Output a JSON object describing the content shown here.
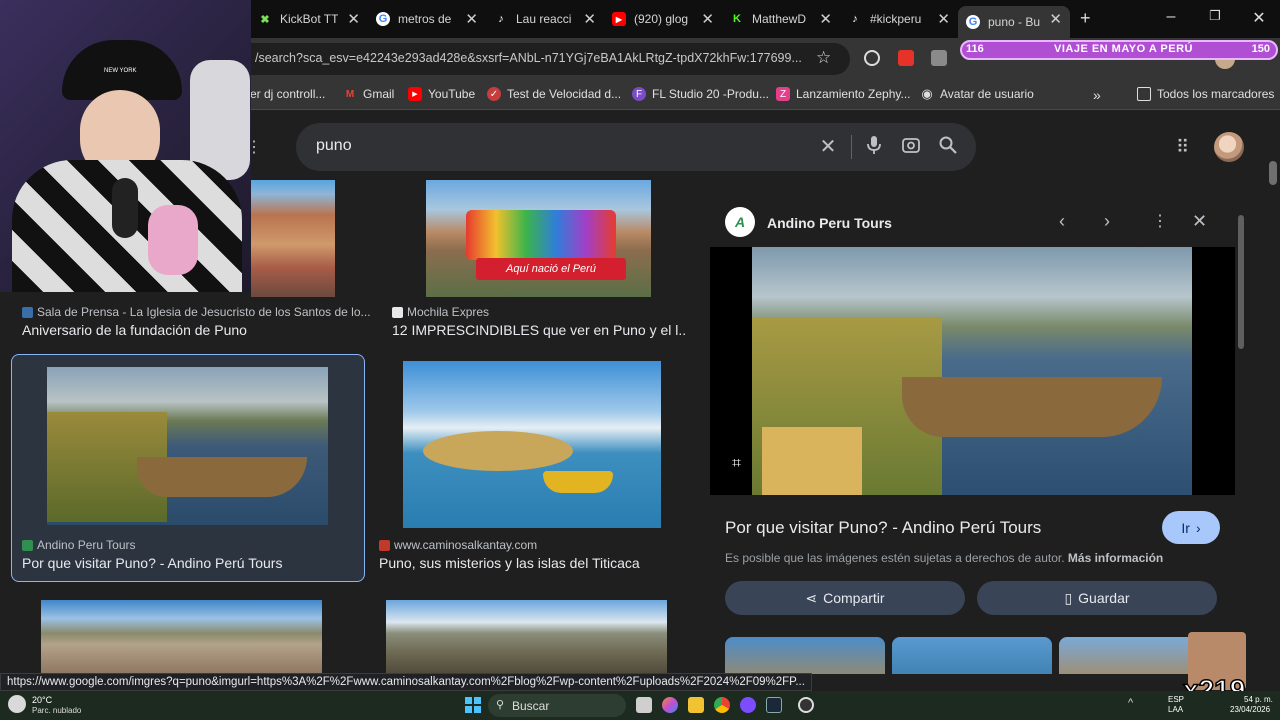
{
  "tabs": [
    {
      "label": "KickBot TT",
      "icon": "kickbot-icon"
    },
    {
      "label": "metros de",
      "icon": "google-icon"
    },
    {
      "label": "Lau reacci",
      "icon": "tiktok-icon"
    },
    {
      "label": "(920) glog",
      "icon": "youtube-icon"
    },
    {
      "label": "MatthewD",
      "icon": "kick-icon"
    },
    {
      "label": "#kickperu",
      "icon": "tiktok-icon"
    },
    {
      "label": "puno - Bu",
      "icon": "google-icon",
      "active": true
    }
  ],
  "address": {
    "url": "/search?sca_esv=e42243e293ad428e&sxsrf=ANbL-n71YGj7eBA1AkLRtgZ-tpdX72khFw:177699..."
  },
  "bookmarks": [
    {
      "label": "er dj controll...",
      "icon": ""
    },
    {
      "label": "Gmail",
      "icon": "gmail-icon"
    },
    {
      "label": "YouTube",
      "icon": "youtube-icon"
    },
    {
      "label": "Test de Velocidad d...",
      "icon": "speedtest-icon"
    },
    {
      "label": "FL Studio 20 -Produ...",
      "icon": "flstudio-icon"
    },
    {
      "label": "Lanzamiento Zephy...",
      "icon": "zephyr-icon"
    },
    {
      "label": "Avatar de usuario",
      "icon": "globe-icon"
    }
  ],
  "bookmarks_all": "Todos los marcadores",
  "stream_badge": {
    "left": "116",
    "text": "VIAJE EN MAYO A PERÚ",
    "right": "150"
  },
  "search": {
    "query": "puno"
  },
  "results": [
    {
      "source": "Sala de Prensa - La Iglesia de Jesucristo de los Santos de lo...",
      "title": "Aniversario de la fundación de Puno"
    },
    {
      "source": "Mochila Expres",
      "title": "12 IMPRESCINDIBLES que ver en Puno y el l..."
    },
    {
      "source": "Andino Peru Tours",
      "title": "Por que visitar Puno? - Andino Perú Tours"
    },
    {
      "source": "www.caminosalkantay.com",
      "title": "Puno, sus misterios y las islas del Titicaca"
    }
  ],
  "panel": {
    "site": "Andino Peru Tours",
    "title": "Por que visitar Puno? - Andino Perú Tours",
    "go": "Ir",
    "copyright": "Es posible que las imágenes estén sujetas a derechos de autor.",
    "more": "Más información",
    "share": "Compartir",
    "save": "Guardar"
  },
  "image_caption": "Aquí nació el Perú",
  "status_url": "https://www.google.com/imgres?q=puno&imgurl=https%3A%2F%2Fwww.caminosalkantay.com%2Fblog%2Fwp-content%2Fuploads%2F2024%2F09%2FP...",
  "taskbar": {
    "weather_temp": "20°C",
    "weather_desc": "Parc. nublado",
    "search": "Buscar",
    "lang": "ESP",
    "lang2": "LAA",
    "time": "54 p. m.",
    "date": "23/04/2026"
  },
  "emote_text": "x219",
  "cap_text": "NEW YORK"
}
